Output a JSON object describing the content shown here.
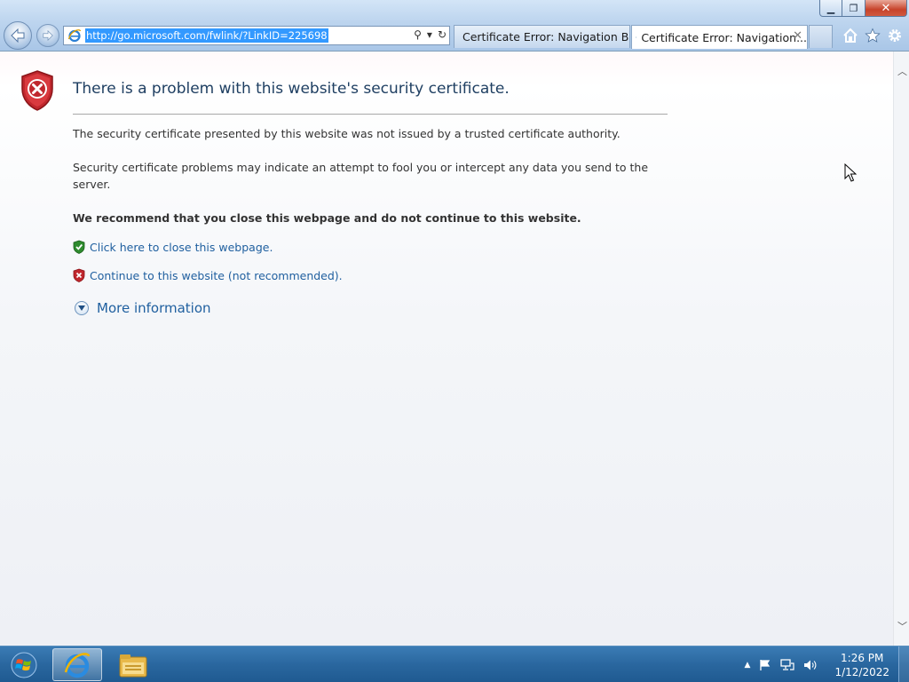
{
  "window": {
    "minimize_glyph": "▁",
    "maximize_glyph": "❐",
    "close_glyph": "✕"
  },
  "addressbar": {
    "url": "http://go.microsoft.com/fwlink/?LinkID=225698",
    "search_glyph": "⚲",
    "dropdown_glyph": "▾",
    "refresh_glyph": "↻"
  },
  "tabs": [
    {
      "title": "Certificate Error: Navigation Bl...",
      "active": false
    },
    {
      "title": "Certificate Error: Navigation...",
      "active": true,
      "close_glyph": "✕"
    }
  ],
  "toolbar": {
    "home_icon": "home-icon",
    "favorites_icon": "star-icon",
    "tools_icon": "gear-icon"
  },
  "page": {
    "title": "There is a problem with this website's security certificate.",
    "paragraph1": "The security certificate presented by this website was not issued by a trusted certificate authority.",
    "paragraph2": "Security certificate problems may indicate an attempt to fool you or intercept any data you send to the server.",
    "recommendation": "We recommend that you close this webpage and do not continue to this website.",
    "close_link": "Click here to close this webpage.",
    "continue_link": "Continue to this website (not recommended).",
    "more_info": "More information"
  },
  "taskbar": {
    "time": "1:26 PM",
    "date": "1/12/2022",
    "tray_arrow": "▲"
  },
  "colors": {
    "link": "#1f5f9f",
    "title": "#1f3f62",
    "error_red": "#c0272d",
    "safe_green": "#2e8b2e"
  }
}
